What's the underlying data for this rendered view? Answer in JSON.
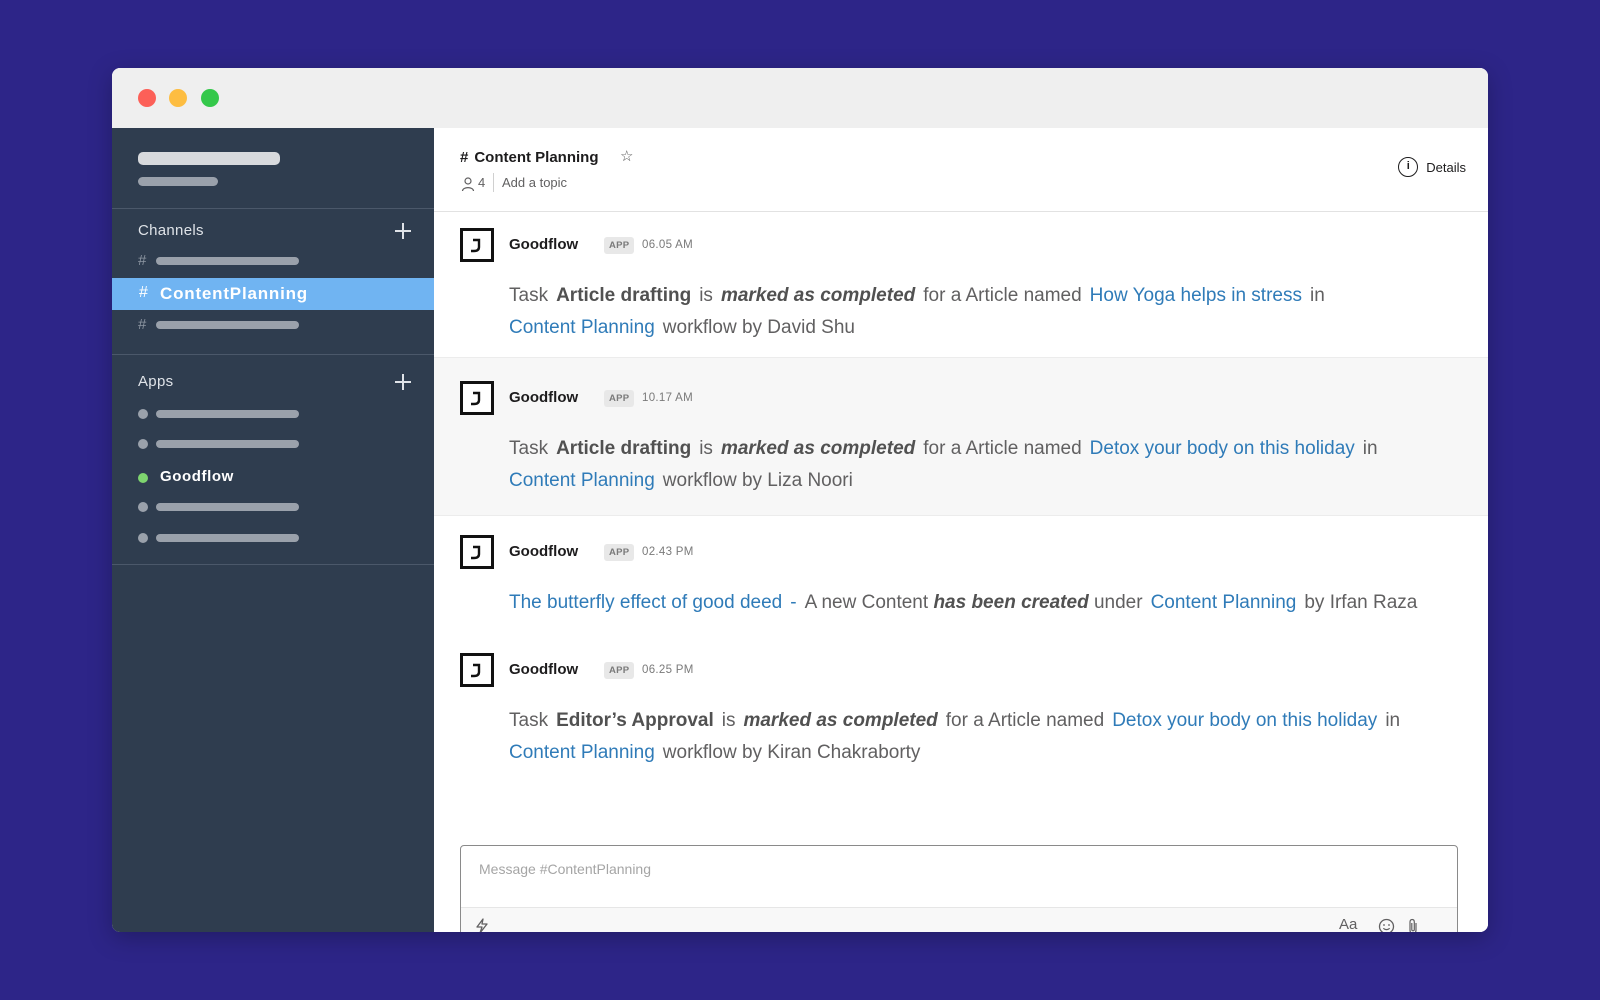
{
  "channel": {
    "name": "Content Planning",
    "member_count": "4",
    "add_topic": "Add a topic",
    "details_label": "Details"
  },
  "sidebar": {
    "channels_heading": "Channels",
    "active_channel": "ContentPlanning",
    "apps_heading": "Apps",
    "active_app": "Goodflow"
  },
  "messages": [
    {
      "sender": "Goodflow",
      "badge": "APP",
      "time": "06.05 AM",
      "parts": [
        "Task",
        "Article drafting",
        "is",
        "marked as completed",
        "for a Article named",
        "How Yoga helps in stress",
        "in",
        "Content Planning",
        "workflow by David Shu"
      ]
    },
    {
      "sender": "Goodflow",
      "badge": "APP",
      "time": "10.17 AM",
      "parts": [
        "Task",
        "Article drafting",
        "is",
        "marked as completed",
        "for a Article named",
        "Detox your body on this holiday",
        "in",
        "Content Planning",
        "workflow by Liza Noori"
      ]
    },
    {
      "sender": "Goodflow",
      "badge": "APP",
      "time": "02.43 PM",
      "parts": [
        "The butterfly effect of good deed",
        "-",
        "A new Content",
        "has been created",
        "under",
        "Content Planning",
        "by Irfan Raza"
      ]
    },
    {
      "sender": "Goodflow",
      "badge": "APP",
      "time": "06.25 PM",
      "parts": [
        "Task",
        "Editor’s Approval",
        "is",
        "marked as completed",
        "for a Article named",
        "Detox your body on this holiday",
        "in",
        "Content Planning",
        "workflow by Kiran Chakraborty"
      ]
    }
  ],
  "composer": {
    "placeholder": "Message #ContentPlanning",
    "format_label": "Aa"
  },
  "icons": [
    "lightning-icon",
    "emoji-icon",
    "attach-icon",
    "star-icon",
    "member-icon",
    "info-icon",
    "plus-icon"
  ],
  "colors": {
    "sidebar": "#2f3d4f",
    "active_item": "#70b4f2",
    "link": "#2f7bb8",
    "background": "#2d2588"
  }
}
